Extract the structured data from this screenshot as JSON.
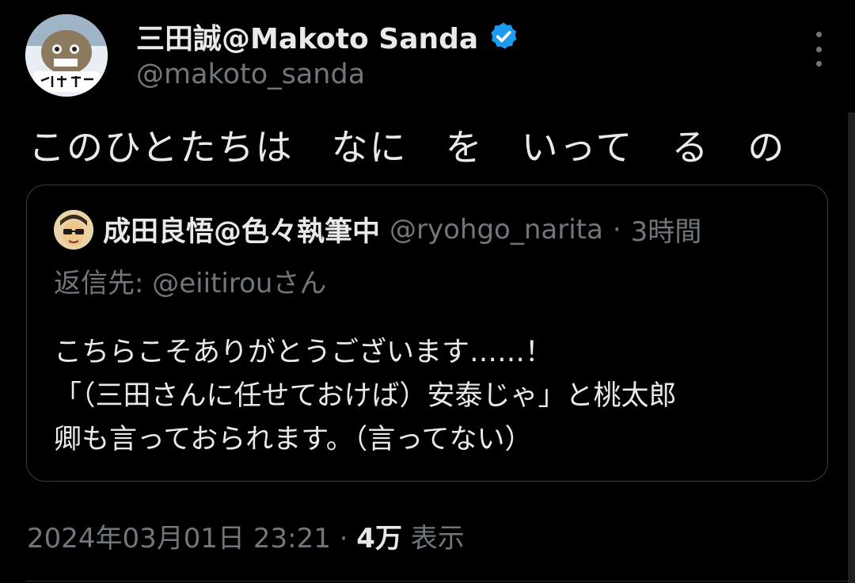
{
  "author": {
    "name": "三田誠@Makoto Sanda",
    "handle": "@makoto_sanda",
    "verified_icon": "verified-badge-icon",
    "verified_color": "#1d9bf0"
  },
  "tweet": {
    "text": "このひとたちは　なに　を　いって　る　の"
  },
  "quoted": {
    "name": "成田良悟@色々執筆中",
    "handle": "@ryohgo_narita",
    "separator": "·",
    "time": "3時間",
    "reply_to": "返信先: @eiitirouさん",
    "lines": [
      "こちらこそありがとうございます……！",
      "「（三田さんに任せておけば）安泰じゃ」と桃太郎",
      "卿も言っておられます。（言ってない）"
    ]
  },
  "meta": {
    "timestamp": "2024年03月01日 23:21",
    "separator": "·",
    "views_count": "4万",
    "views_label": "表示"
  },
  "colors": {
    "background": "#000000",
    "text": "#e7e9ea",
    "secondary": "#71767b",
    "border": "#3a3d41"
  },
  "icons": {
    "more": "more-vertical-icon"
  }
}
